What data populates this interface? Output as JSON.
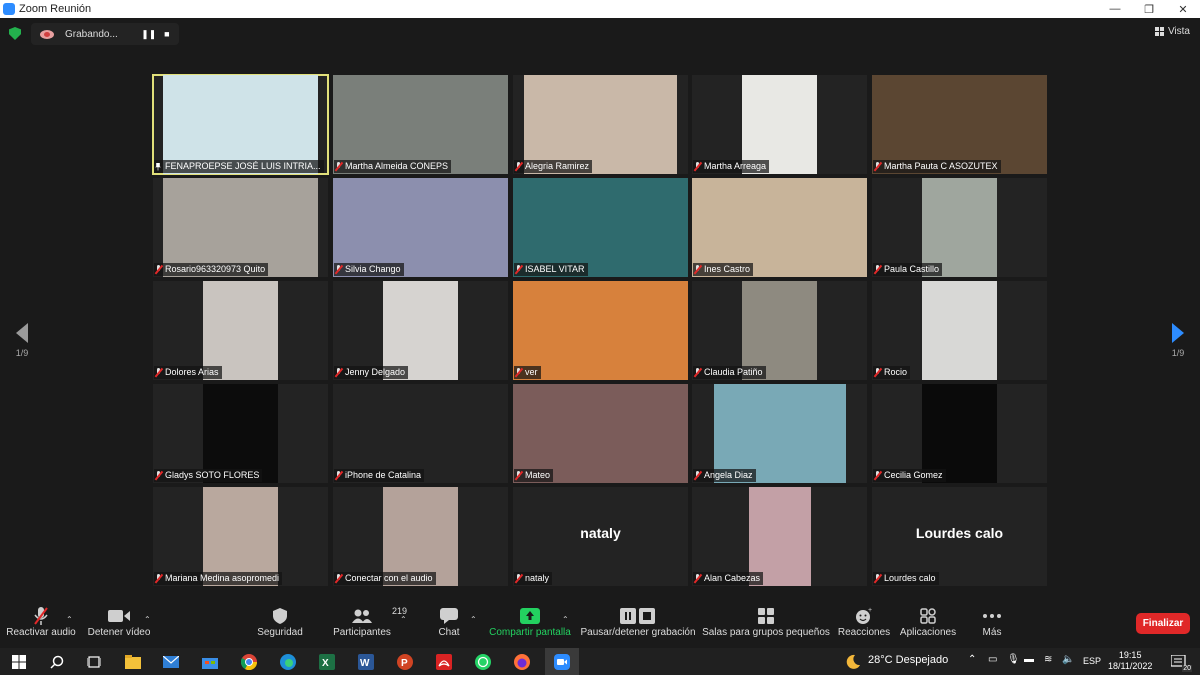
{
  "window": {
    "title": "Zoom Reunión"
  },
  "recording": {
    "label": "Grabando..."
  },
  "view": {
    "label": "Vista"
  },
  "pager": {
    "left": "1/9",
    "right": "1/9"
  },
  "participants": [
    {
      "name": "FENAPROEPSE JOSÉ LUIS INTRIA...",
      "pinned": true,
      "active": true,
      "bg": "#cfe3e8"
    },
    {
      "name": "Martha Almeida CONEPS",
      "bg": "#7a7f7a"
    },
    {
      "name": "Alegria Ramirez",
      "bg": "#c9b8a8"
    },
    {
      "name": "Martha Arreaga",
      "bg": "#e8e8e4"
    },
    {
      "name": "Martha Pauta C ASOZUTEX",
      "bg": "#5b4632"
    },
    {
      "name": "Rosario963320973 Quito",
      "bg": "#a7a29b"
    },
    {
      "name": "Silvia Chango",
      "bg": "#8c8fae"
    },
    {
      "name": "ISABEL VITAR",
      "bg": "#2f6b6e"
    },
    {
      "name": "Ines Castro",
      "bg": "#c8b49a"
    },
    {
      "name": "Paula Castillo",
      "bg": "#9fa69e"
    },
    {
      "name": "Dolores Arias",
      "bg": "#c9c4bf"
    },
    {
      "name": "Jenny Delgado",
      "bg": "#d6d3d0"
    },
    {
      "name": "ver",
      "bg": "#d7813c"
    },
    {
      "name": "Claudia Patiño",
      "bg": "#8e8a80"
    },
    {
      "name": "Rocio",
      "bg": "#d8d8d6"
    },
    {
      "name": "Gladys SOTO FLORES",
      "bg": "#0c0c0c"
    },
    {
      "name": "iPhone de Catalina",
      "bg": ""
    },
    {
      "name": "Mateo",
      "bg": "#7b5c5a"
    },
    {
      "name": "Angela Diaz",
      "bg": "#79a9b6"
    },
    {
      "name": "Cecilia Gomez",
      "bg": "#0a0a0a"
    },
    {
      "name": "Mariana Medina asopromedi",
      "bg": "#b9a89e"
    },
    {
      "name": "Conectar con el audio",
      "bg": "#b4a29a"
    },
    {
      "name": "nataly",
      "big": "nataly",
      "bg": ""
    },
    {
      "name": "Alan Cabezas",
      "bg": "#c3a0a6"
    },
    {
      "name": "Lourdes calo",
      "big": "Lourdes calo",
      "bg": ""
    }
  ],
  "toolbar": {
    "audio": "Reactivar audio",
    "video": "Detener vídeo",
    "security": "Seguridad",
    "participants": "Participantes",
    "participants_count": "219",
    "chat": "Chat",
    "share": "Compartir pantalla",
    "recording": "Pausar/detener grabación",
    "breakout": "Salas para grupos pequeños",
    "reactions": "Reacciones",
    "apps": "Aplicaciones",
    "more": "Más",
    "end": "Finalizar"
  },
  "taskbar": {
    "weather": "28°C  Despejado",
    "lang": "ESP",
    "time": "19:15",
    "date": "18/11/2022",
    "notifications": "20"
  },
  "colors": {
    "accent": "#2d8cff",
    "danger": "#e02828",
    "share": "#23d160",
    "active_border": "#e1e07a"
  }
}
